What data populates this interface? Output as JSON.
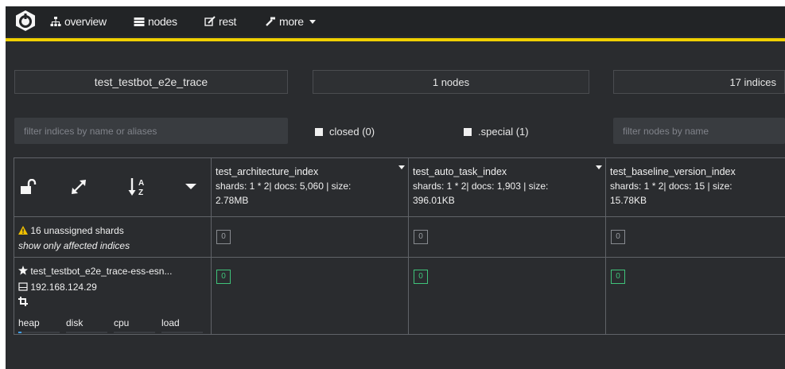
{
  "nav": {
    "overview": "overview",
    "nodes": "nodes",
    "rest": "rest",
    "more": "more"
  },
  "summary": {
    "cluster_name": "test_testbot_e2e_trace",
    "nodes_count": "1 nodes",
    "indices_count": "17 indices"
  },
  "filters": {
    "indices_placeholder": "filter indices by name or aliases",
    "nodes_placeholder": "filter nodes by name",
    "closed_label": "closed (0)",
    "special_label": ".special (1)"
  },
  "indices": [
    {
      "name": "test_architecture_index",
      "info": "shards: 1 * 2| docs: 5,060 | size:",
      "size": "2.78MB"
    },
    {
      "name": "test_auto_task_index",
      "info": "shards: 1 * 2| docs: 1,903 | size:",
      "size": "396.01KB"
    },
    {
      "name": "test_baseline_version_index",
      "info": "shards: 1 * 2| docs: 15 | size:",
      "size": "15.78KB"
    }
  ],
  "unassigned": {
    "title": "16 unassigned shards",
    "link": "show only affected indices",
    "shard_label": "0"
  },
  "node": {
    "name": "test_testbot_e2e_trace-ess-esn...",
    "ip": "192.168.124.29",
    "shard_label": "0",
    "stats": {
      "heap": "heap",
      "disk": "disk",
      "cpu": "cpu",
      "load": "load"
    },
    "heap_level": 0.08
  },
  "colors": {
    "accent": "#f0d000",
    "started_shard": "#3fc37a",
    "warning": "#f0c000"
  }
}
